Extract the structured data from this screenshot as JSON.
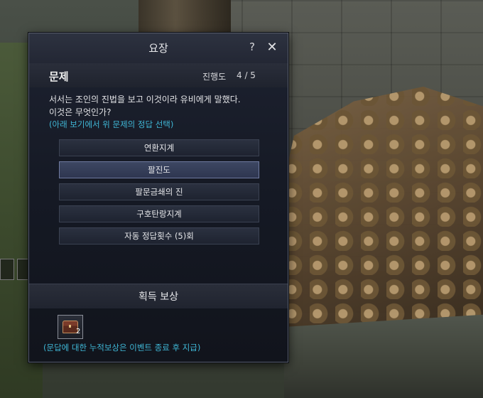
{
  "dialog": {
    "title": "요장",
    "help_label": "?",
    "close_label": "✕"
  },
  "problem": {
    "title": "문제",
    "progress_label": "진행도",
    "progress_value": "4 / 5",
    "question_line1": "서서는 조인의 진법을 보고 이것이라 유비에게 말했다.",
    "question_line2": "이것은 무엇인가?",
    "hint": "(아래 보기에서 위 문제의 정답 선택)"
  },
  "options": [
    {
      "label": "연환지계",
      "selected": false
    },
    {
      "label": "팔진도",
      "selected": true
    },
    {
      "label": "팔문금쇄의 진",
      "selected": false
    },
    {
      "label": "구호탄랑지계",
      "selected": false
    },
    {
      "label": "자동 정답횟수 (5)회",
      "selected": false
    }
  ],
  "reward": {
    "title": "획득 보상",
    "item_icon": "treasure-chest-icon",
    "item_count": "2",
    "note": "(문답에 대한 누적보상은 이벤트 종료 후 지급)"
  },
  "colors": {
    "hint": "#3fb7d6",
    "panel_bg": "#151924",
    "selected_option": "#3d4762"
  }
}
